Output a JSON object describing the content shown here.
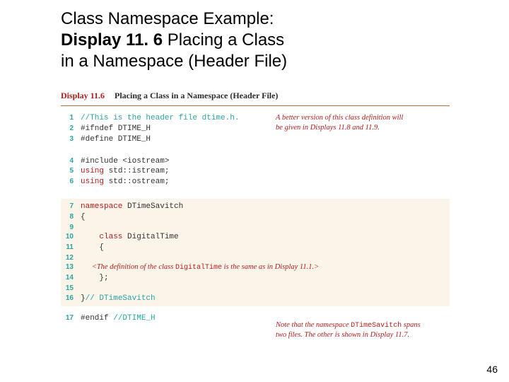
{
  "title": {
    "line1_prefix": "Class Namespace Example:",
    "line2_bold": "Display 11. 6",
    "line2_rest": "  Placing a Class",
    "line3": "in a Namespace (Header File)"
  },
  "figure": {
    "display_label": "Display 11.6",
    "caption": "Placing a Class in a Namespace (Header File)"
  },
  "annot1": {
    "l1": "A better version of this class definition will",
    "l2": "be given in Displays 11.8 and 11.9."
  },
  "code": {
    "l1": "//This is the header file dtime.h.",
    "l2": "#ifndef DTIME_H",
    "l3": "#define DTIME_H",
    "l4": "#include <iostream>",
    "l5a": "using",
    "l5b": " std::istream;",
    "l6a": "using",
    "l6b": " std::ostream;",
    "l7a": "namespace",
    "l7b": " DTimeSavitch",
    "l8": "{",
    "l10a": "    class",
    "l10b": " DigitalTime",
    "l11": "    {",
    "placeholder_pre": "      <The definition of the class ",
    "placeholder_mono": "DigitalTime",
    "placeholder_post": " is the same as in Display 11.1.>",
    "l14": "    };",
    "l16a": "}",
    "l16b": "// DTimeSavitch",
    "l17a": "#endif ",
    "l17b": "//DTIME_H"
  },
  "ln": {
    "n1": "1",
    "n2": "2",
    "n3": "3",
    "n4": "4",
    "n5": "5",
    "n6": "6",
    "n7": "7",
    "n8": "8",
    "n9": "9",
    "n10": "10",
    "n11": "11",
    "n12": "12",
    "n13": "13",
    "n14": "14",
    "n15": "15",
    "n16": "16",
    "n17": "17"
  },
  "annot2": {
    "l1_pre": "Note that the namespace ",
    "l1_mono": "DTimeSavitch",
    "l1_post": " spans",
    "l2": "two files. The other is shown in Display 11.7."
  },
  "pagenum": "46"
}
